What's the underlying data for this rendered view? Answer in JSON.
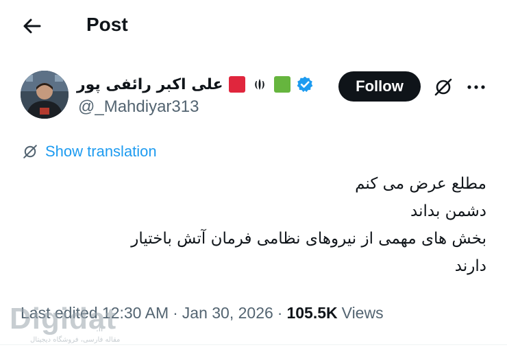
{
  "header": {
    "title": "Post",
    "back_icon": "arrow-left-icon"
  },
  "author": {
    "display_name": "علی اکبر رائفی پور",
    "handle": "@_Mahdiyar313",
    "verified": true,
    "badges": [
      "red-square-flag",
      "iran-emblem",
      "green-square-flag"
    ],
    "colors": {
      "red": "#e0263d",
      "green": "#66b53e",
      "verified": "#1d9bf0"
    }
  },
  "actions": {
    "follow_label": "Follow",
    "grok_icon": "no-translate-icon",
    "more_icon": "more-dots-icon"
  },
  "translation": {
    "label": "Show translation",
    "icon": "translate-off-icon",
    "color": "#1d9bf0"
  },
  "tweet": {
    "lines": [
      "مطلع عرض می کنم",
      "دشمن بداند",
      "بخش های مهمی از نیروهای نظامی فرمان آتش باختیار",
      "دارند"
    ]
  },
  "meta": {
    "edited": "Last edited 12:30 AM",
    "date": "Jan 30, 2026",
    "views_count": "105.5K",
    "views_label": "Views",
    "separator": "·"
  },
  "watermark": {
    "logo": "Digidat",
    "tld": ".ir",
    "subtitle": "مقاله فارسی، فروشگاه دیجیتال"
  }
}
